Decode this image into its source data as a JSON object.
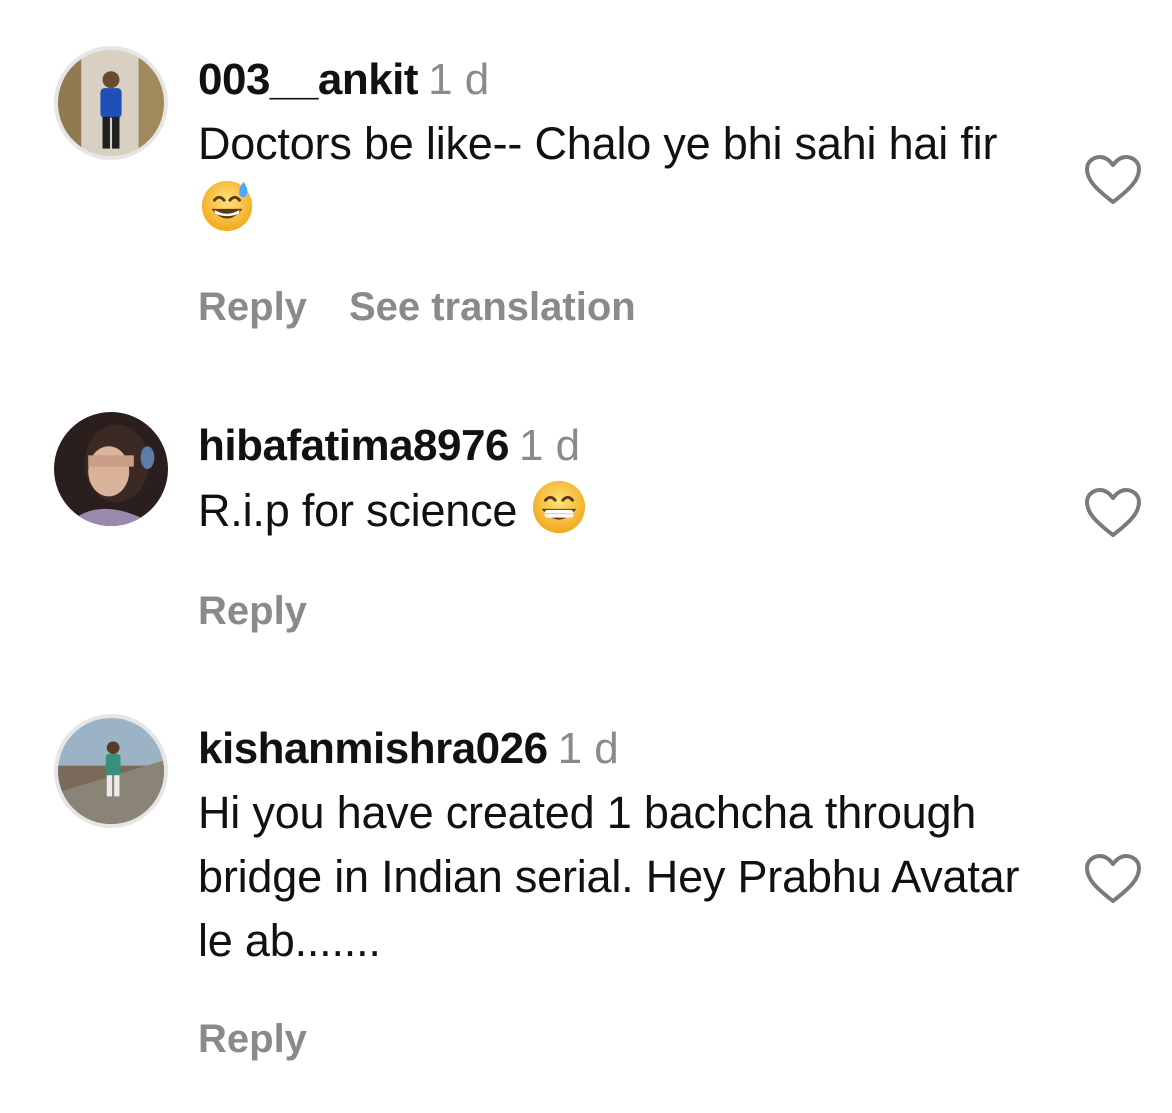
{
  "comments": [
    {
      "username": "003__ankit",
      "time": "1 d",
      "text": "Doctors be like-- Chalo ye bhi sahi hai fir",
      "emoji": "sweat-smile-emoji",
      "actions": {
        "reply": "Reply",
        "see_translation": "See translation"
      }
    },
    {
      "username": "hibafatima8976",
      "time": "1 d",
      "text": "R.i.p for science ",
      "emoji": "grin-emoji",
      "actions": {
        "reply": "Reply"
      }
    },
    {
      "username": "kishanmishra026",
      "time": "1 d",
      "text": "Hi you have created 1 bachcha through bridge in Indian serial. Hey Prabhu Avatar le ab.......",
      "actions": {
        "reply": "Reply"
      }
    }
  ],
  "icons": {
    "like": "heart-outline-icon"
  },
  "colors": {
    "text": "#111111",
    "secondary": "#8a8a8a",
    "background": "#ffffff"
  }
}
